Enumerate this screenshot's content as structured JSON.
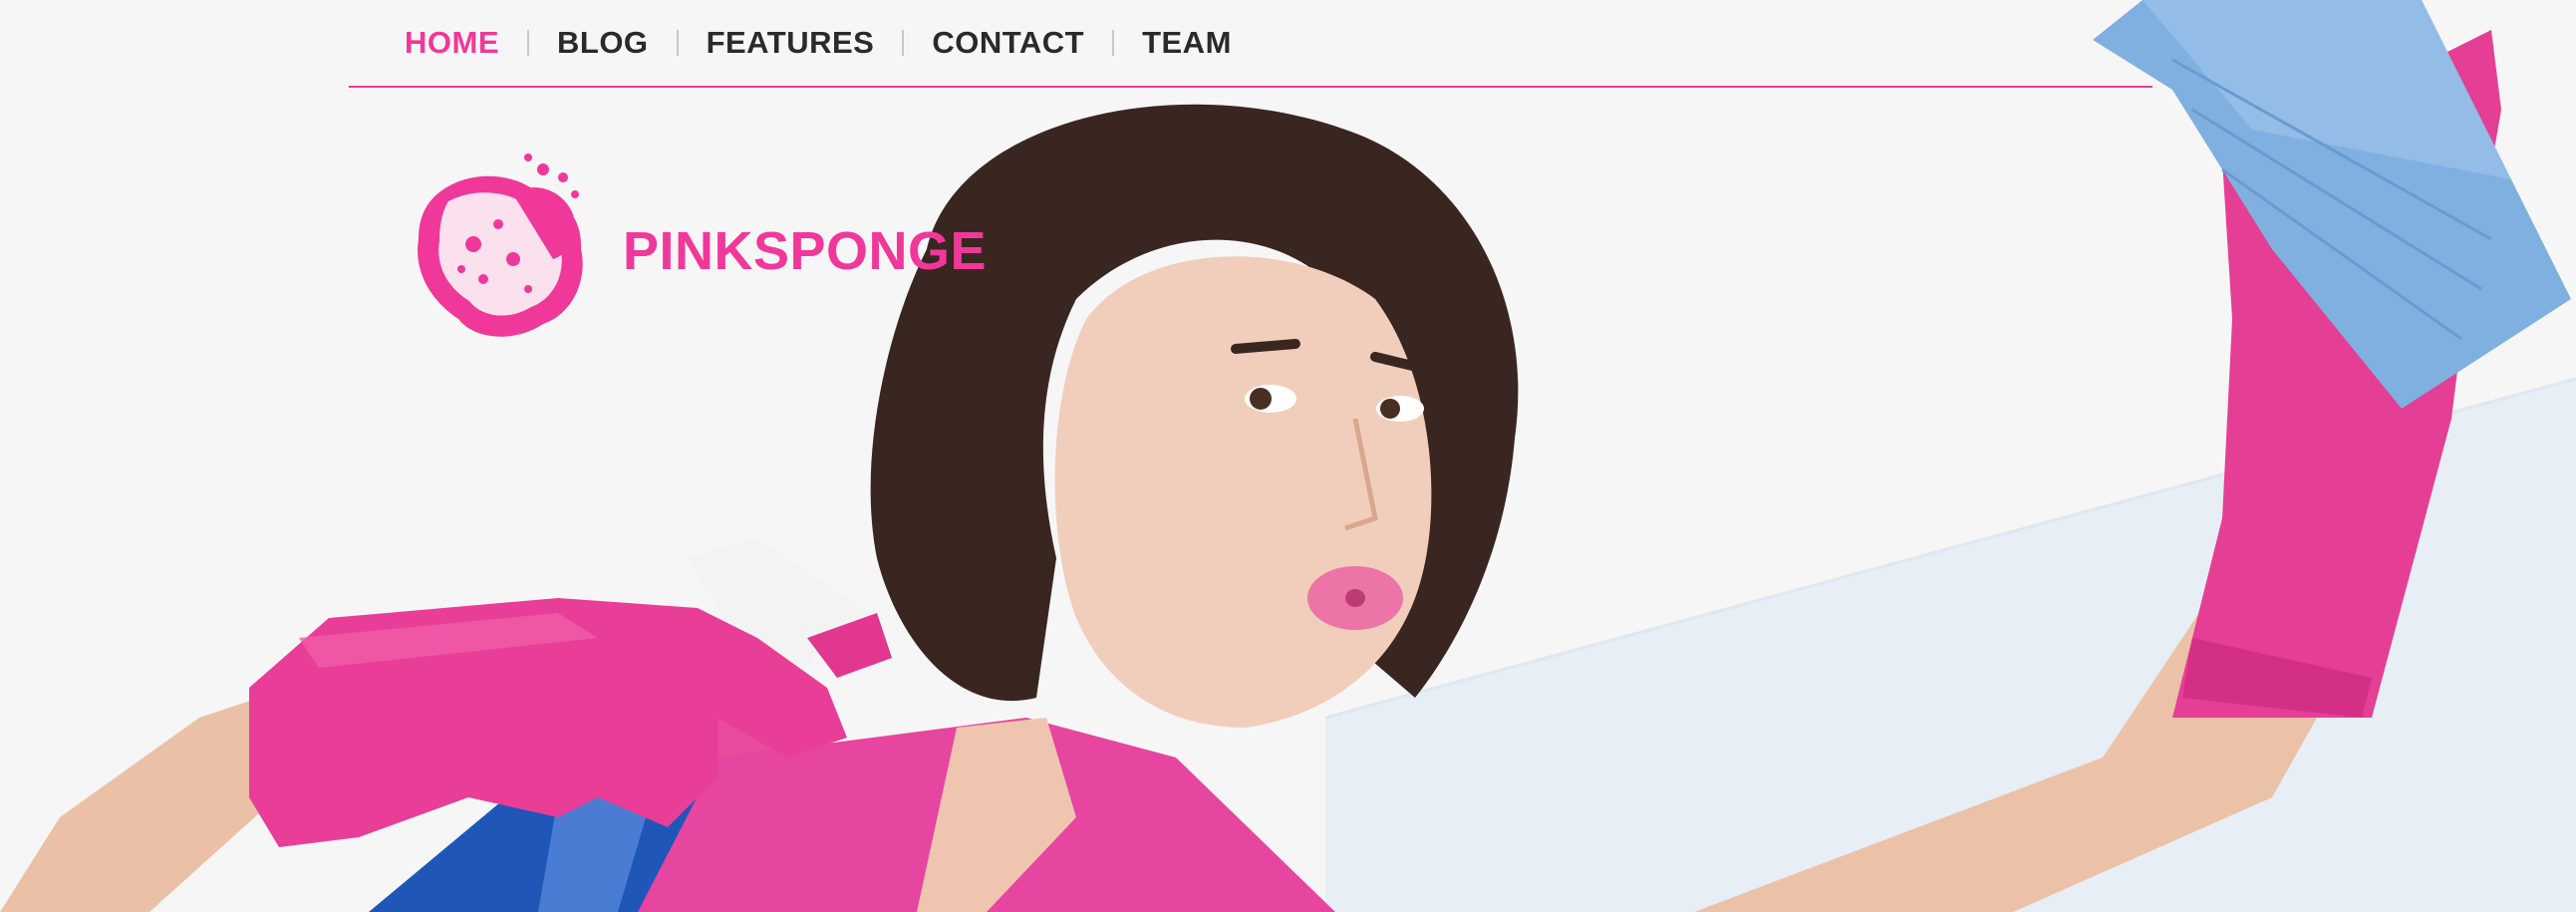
{
  "nav": {
    "items": [
      {
        "label": "HOME",
        "active": true
      },
      {
        "label": "BLOG",
        "active": false
      },
      {
        "label": "FEATURES",
        "active": false
      },
      {
        "label": "CONTACT",
        "active": false
      },
      {
        "label": "TEAM",
        "active": false
      }
    ]
  },
  "brand": {
    "name": "PINKSPONGE",
    "logo_icon": "sponge-icon"
  },
  "colors": {
    "accent": "#f0389a",
    "nav_text": "#2a2a2a",
    "background": "#f6f6f7",
    "cloth": "#7fb0e0"
  }
}
